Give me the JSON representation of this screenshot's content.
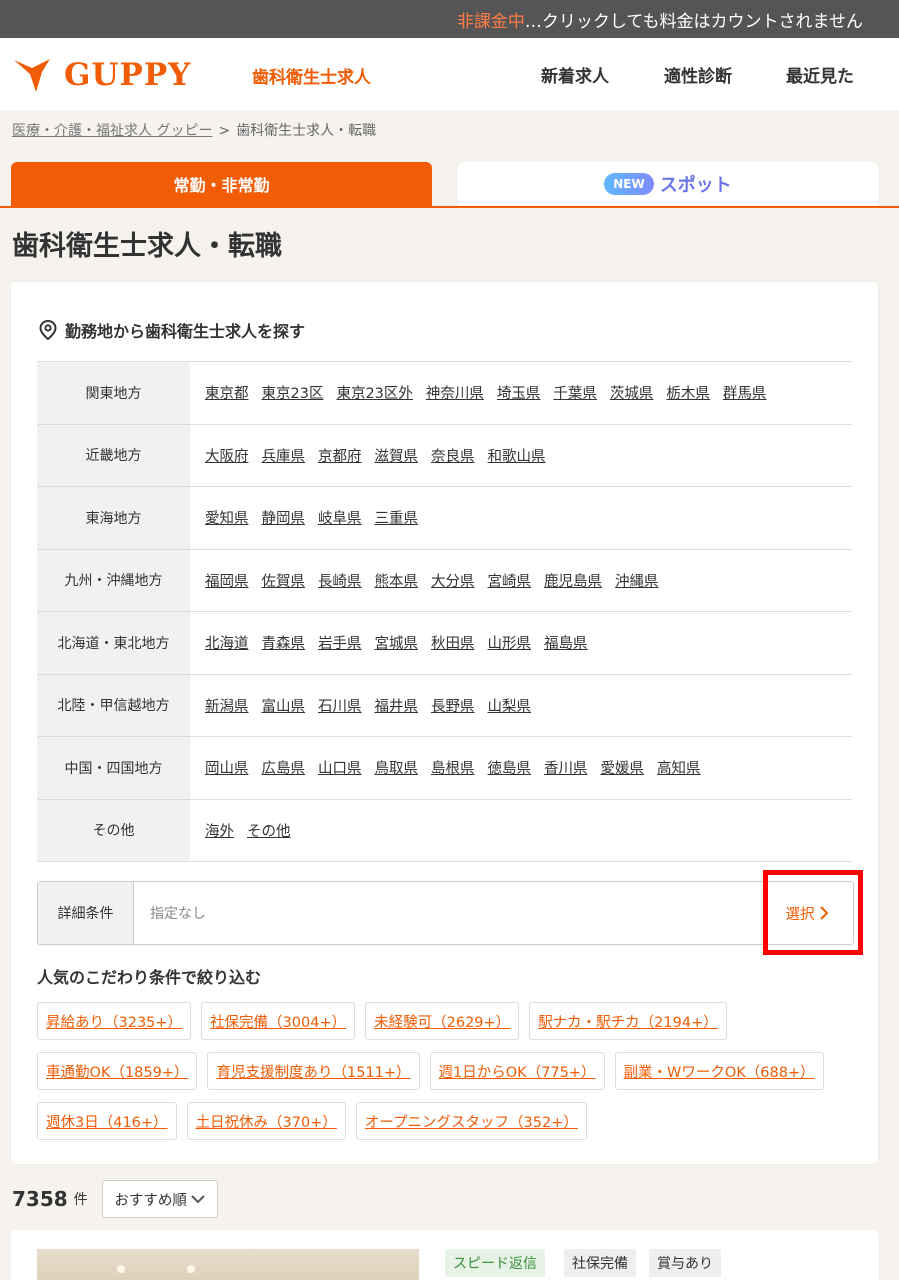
{
  "notice": {
    "warn": "非課金中",
    "rest": "…クリックしても料金はカウントされません"
  },
  "header": {
    "logo_text": "GUPPY",
    "category": "歯科衛生士求人",
    "nav": [
      "新着求人",
      "適性診断",
      "最近見た"
    ]
  },
  "breadcrumb": {
    "home": "医療・介護・福祉求人 グッピー",
    "separator": ">",
    "current": "歯科衛生士求人・転職"
  },
  "tabs": {
    "active": "常勤・非常勤",
    "new_badge": "NEW",
    "spot": "スポット"
  },
  "page_title": "歯科衛生士求人・転職",
  "location_search": {
    "heading": "勤務地から歯科衛生士求人を探す",
    "regions": [
      {
        "name": "関東地方",
        "prefectures": [
          "東京都",
          "東京23区",
          "東京23区外",
          "神奈川県",
          "埼玉県",
          "千葉県",
          "茨城県",
          "栃木県",
          "群馬県"
        ]
      },
      {
        "name": "近畿地方",
        "prefectures": [
          "大阪府",
          "兵庫県",
          "京都府",
          "滋賀県",
          "奈良県",
          "和歌山県"
        ]
      },
      {
        "name": "東海地方",
        "prefectures": [
          "愛知県",
          "静岡県",
          "岐阜県",
          "三重県"
        ]
      },
      {
        "name": "九州・沖縄地方",
        "prefectures": [
          "福岡県",
          "佐賀県",
          "長崎県",
          "熊本県",
          "大分県",
          "宮崎県",
          "鹿児島県",
          "沖縄県"
        ]
      },
      {
        "name": "北海道・東北地方",
        "prefectures": [
          "北海道",
          "青森県",
          "岩手県",
          "宮城県",
          "秋田県",
          "山形県",
          "福島県"
        ]
      },
      {
        "name": "北陸・甲信越地方",
        "prefectures": [
          "新潟県",
          "富山県",
          "石川県",
          "福井県",
          "長野県",
          "山梨県"
        ]
      },
      {
        "name": "中国・四国地方",
        "prefectures": [
          "岡山県",
          "広島県",
          "山口県",
          "鳥取県",
          "島根県",
          "徳島県",
          "香川県",
          "愛媛県",
          "高知県"
        ]
      },
      {
        "name": "その他",
        "prefectures": [
          "海外",
          "その他"
        ]
      }
    ]
  },
  "detail_conditions": {
    "label": "詳細条件",
    "value": "指定なし",
    "select": "選択"
  },
  "popular": {
    "heading": "人気のこだわり条件で絞り込む",
    "chips": [
      "昇給あり（3235+）",
      "社保完備（3004+）",
      "未経験可（2629+）",
      "駅ナカ・駅チカ（2194+）",
      "車通勤OK（1859+）",
      "育児支援制度あり（1511+）",
      "週1日からOK（775+）",
      "副業・WワークOK（688+）",
      "週休3日（416+）",
      "土日祝休み（370+）",
      "オープニングスタッフ（352+）"
    ]
  },
  "results": {
    "count": "7358",
    "unit": "件",
    "sort": "おすすめ順"
  },
  "job": {
    "tags": [
      "スピード返信",
      "社保完備",
      "賞与あり"
    ]
  },
  "colors": {
    "accent": "#f25c05",
    "highlight": "#ff0000"
  }
}
